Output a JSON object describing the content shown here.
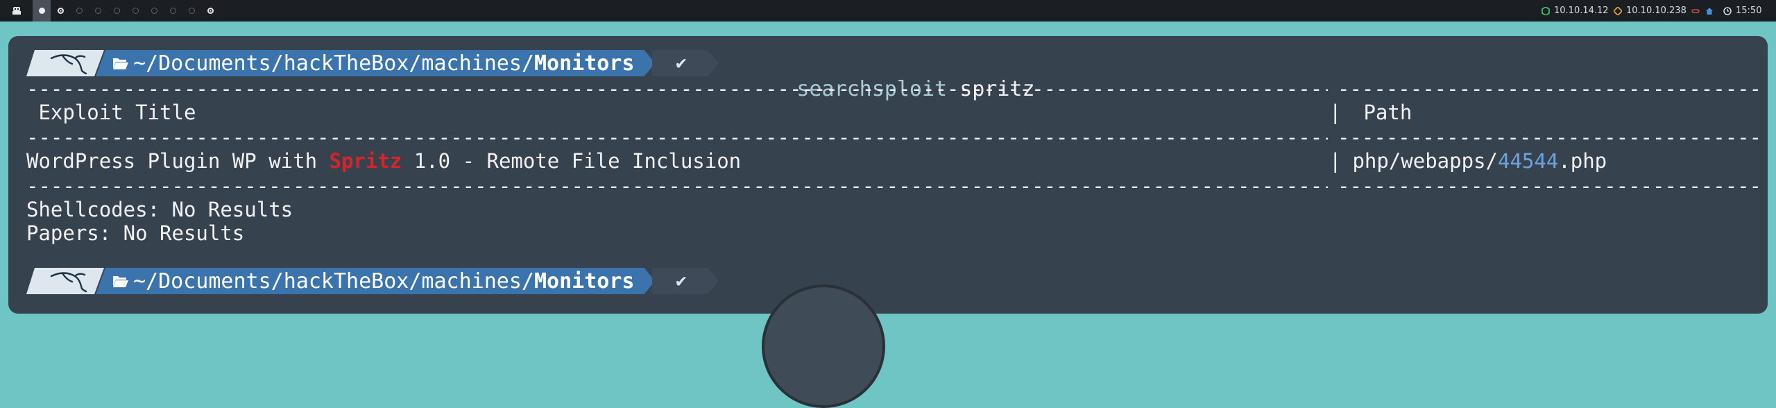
{
  "topbar": {
    "workspaces": [
      "",
      "",
      "",
      "",
      "",
      "",
      "",
      "",
      "",
      "",
      ""
    ],
    "ip_local": "10.10.14.12",
    "ip_target": "10.10.10.238",
    "time": "15:50",
    "colors": {
      "local_ip_icon": "#3fbf5f",
      "target_ip_icon": "#e0a030",
      "vpn_icon": "#d24a4a",
      "home_icon": "#4a90e0"
    }
  },
  "prompt": {
    "path_prefix": "~/Documents/hackTheBox/machines/",
    "path_current": "Monitors",
    "check": "✔",
    "command": "searchsploit",
    "argument": "spritz"
  },
  "results": {
    "header_title": " Exploit Title",
    "header_sep": "|",
    "header_path": " Path",
    "row_title_pre": "WordPress Plugin WP with ",
    "row_title_match": "Spritz",
    "row_title_post": " 1.0 - Remote File Inclusion",
    "row_sep": "|",
    "row_path_pre": " php/webapps/",
    "row_path_id": "44544",
    "row_path_post": ".php",
    "shellcodes": "Shellcodes: No Results",
    "papers": "Papers: No Results"
  }
}
